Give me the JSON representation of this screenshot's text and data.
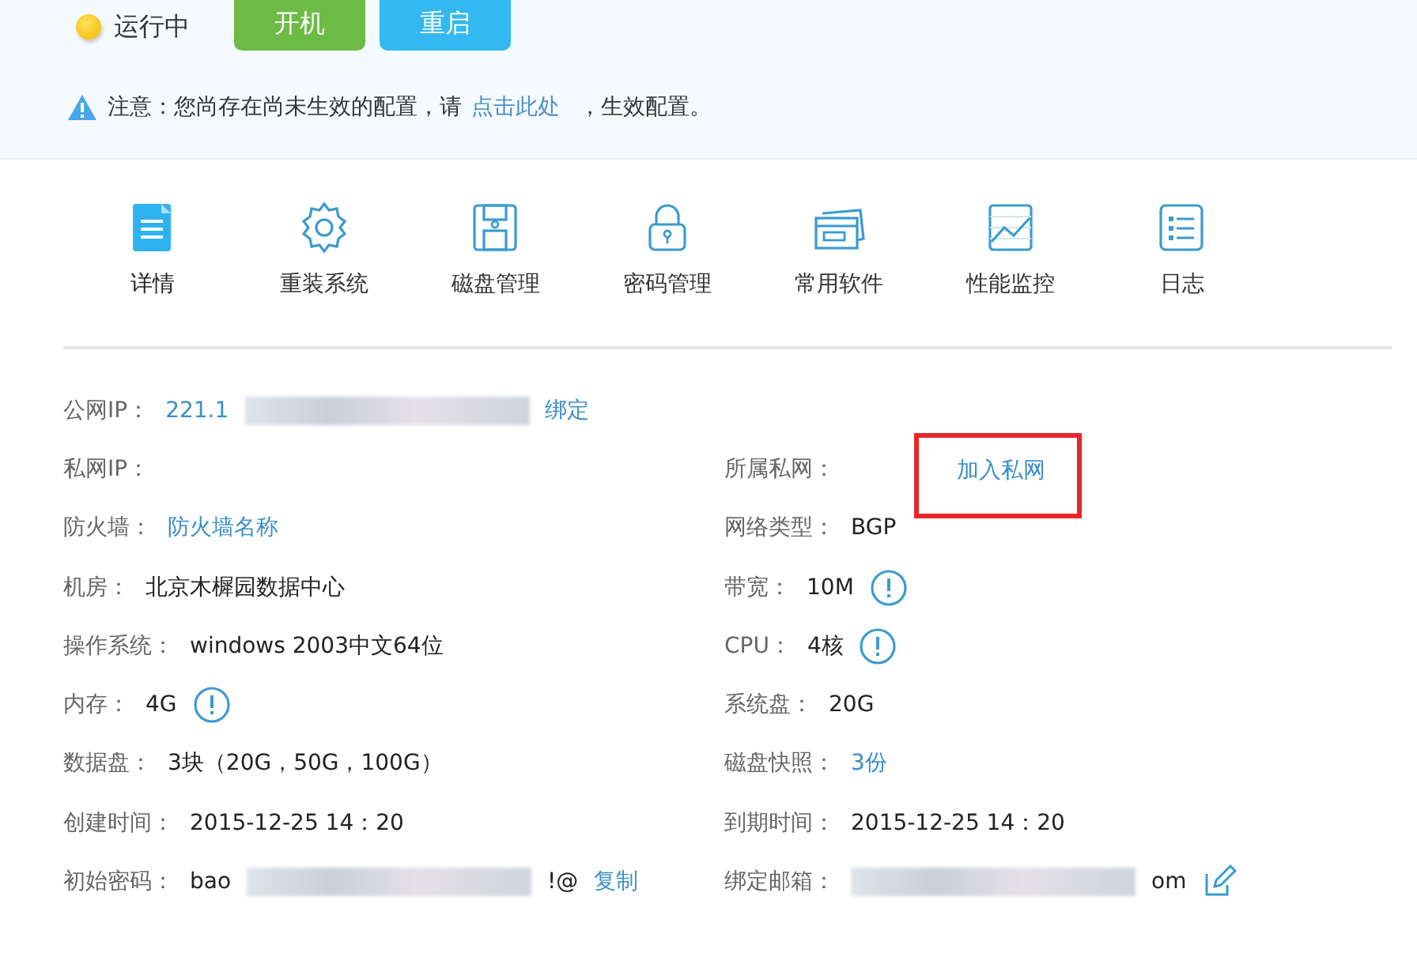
{
  "status": {
    "label": "运行中"
  },
  "buttons": [
    {
      "label": "开机",
      "kind": "start"
    },
    {
      "label": "重启",
      "kind": "restart"
    }
  ],
  "notice": {
    "parts": [
      {
        "kind": "text",
        "text": "注意：您尚存在尚未生效的配置，请"
      },
      {
        "kind": "link",
        "text": "点击此处"
      },
      {
        "kind": "text",
        "text": "，生效配置。"
      }
    ]
  },
  "toolbar": [
    {
      "label": "详情",
      "selected": true
    },
    {
      "label": "重装系统",
      "selected": false
    },
    {
      "label": "磁盘管理",
      "selected": false
    },
    {
      "label": "密码管理",
      "selected": false
    },
    {
      "label": "常用软件",
      "selected": false
    },
    {
      "label": "性能监控",
      "selected": false
    },
    {
      "label": "日志",
      "selected": false
    }
  ],
  "left_fields": [
    {
      "label": "公网IP：",
      "highlighted": false,
      "parts": [
        {
          "kind": "link",
          "text": "221.1"
        },
        {
          "kind": "redacted"
        },
        {
          "kind": "link",
          "text": "绑定"
        }
      ]
    },
    {
      "label": "私网IP：",
      "highlighted": false
    },
    {
      "label": "防火墙：",
      "highlighted": false,
      "parts": [
        {
          "kind": "link",
          "text": "防火墙名称"
        }
      ]
    },
    {
      "label": "机房：",
      "highlighted": false,
      "parts": [
        {
          "kind": "text",
          "text": "北京木樨园数据中心"
        }
      ]
    },
    {
      "label": "操作系统：",
      "highlighted": false,
      "parts": [
        {
          "kind": "text",
          "text": "windows 2003中文64位"
        }
      ]
    },
    {
      "label": "内存：",
      "highlighted": false,
      "parts": [
        {
          "kind": "text",
          "text": "4G"
        },
        {
          "kind": "info"
        }
      ]
    },
    {
      "label": "数据盘：",
      "highlighted": false,
      "parts": [
        {
          "kind": "text",
          "text": "3块（20G，50G，100G）"
        }
      ]
    },
    {
      "label": "创建时间：",
      "highlighted": false,
      "parts": [
        {
          "kind": "text",
          "text": "2015-12-25 14：20"
        }
      ]
    },
    {
      "label": "初始密码：",
      "highlighted": false,
      "parts": [
        {
          "kind": "text",
          "text": "bao"
        },
        {
          "kind": "redacted"
        },
        {
          "kind": "text",
          "text": "!@"
        },
        {
          "kind": "link",
          "text": "复制"
        }
      ]
    }
  ],
  "right_fields": [
    {
      "label": "所属私网：",
      "highlighted": true,
      "parts": [
        {
          "kind": "link",
          "text": "加入私网"
        }
      ]
    },
    {
      "label": "网络类型：",
      "highlighted": false,
      "parts": [
        {
          "kind": "text",
          "text": "BGP"
        }
      ]
    },
    {
      "label": "带宽：",
      "highlighted": false,
      "parts": [
        {
          "kind": "text",
          "text": "10M"
        },
        {
          "kind": "info"
        }
      ]
    },
    {
      "label": "CPU：",
      "highlighted": false,
      "parts": [
        {
          "kind": "text",
          "text": "4核"
        },
        {
          "kind": "info"
        }
      ]
    },
    {
      "label": "系统盘：",
      "highlighted": false,
      "parts": [
        {
          "kind": "text",
          "text": "20G"
        }
      ]
    },
    {
      "label": "磁盘快照：",
      "highlighted": false,
      "parts": [
        {
          "kind": "link",
          "text": "3份"
        }
      ]
    },
    {
      "label": "到期时间：",
      "highlighted": false,
      "parts": [
        {
          "kind": "text",
          "text": "2015-12-25 14：20"
        }
      ]
    },
    {
      "label": "绑定邮箱：",
      "highlighted": false,
      "parts": [
        {
          "kind": "redacted"
        },
        {
          "kind": "text",
          "text": "om"
        },
        {
          "kind": "edit"
        }
      ]
    }
  ]
}
